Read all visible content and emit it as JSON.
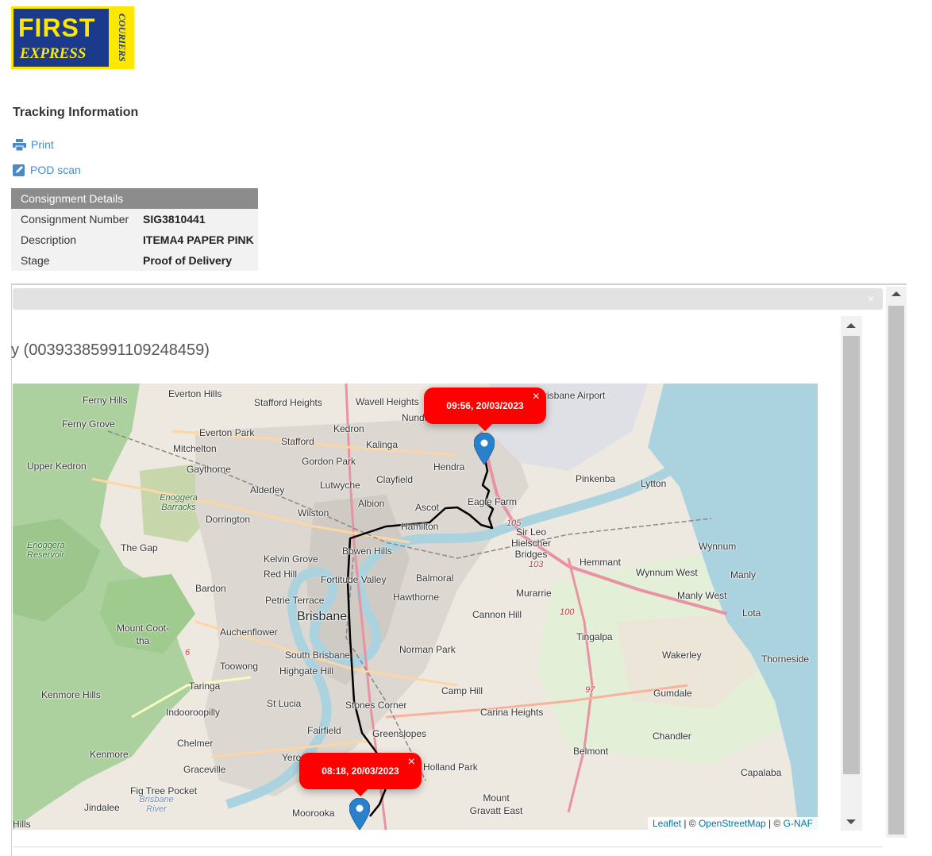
{
  "logo": {
    "first": "FIRST",
    "express": "EXPRESS",
    "couriers": "COURIERS"
  },
  "page": {
    "title": "Tracking Information"
  },
  "actions": {
    "print": "Print",
    "pod_scan": "POD scan"
  },
  "consignment": {
    "header": "Consignment Details",
    "rows": [
      {
        "label": "Consignment Number",
        "value": "SIG3810441"
      },
      {
        "label": "Description",
        "value": "ITEMA4 PAPER PINK"
      },
      {
        "label": "Stage",
        "value": "Proof of Delivery"
      }
    ]
  },
  "modal": {
    "close": "×",
    "tracking_heading": "y (00393385991109248459)"
  },
  "map": {
    "popups": [
      {
        "time": "09:56, 20/03/2023",
        "close": "×"
      },
      {
        "time": "08:18, 20/03/2023",
        "close": "×"
      }
    ],
    "attribution": {
      "leaflet": "Leaflet",
      "sep1": " | © ",
      "osm": "OpenStreetMap",
      "sep2": " | © ",
      "gnaf": "G-NAF"
    },
    "places": [
      "Ferny Hills",
      "Everton Hills",
      "Stafford Heights",
      "Wavell Heights",
      "Nundah",
      "Ferny Grove",
      "Everton Park",
      "Kedron",
      "Stafford",
      "Kalinga",
      "Mitchelton",
      "Gordon Park",
      "Hendra",
      "Upper Kedron",
      "Gaythorne",
      "Lutwyche",
      "Clayfield",
      "Pinkenba",
      "Lytton",
      "Alderley",
      "Albion",
      "Eagle Farm",
      "Ascot",
      "Enoggera Barracks",
      "Dorrington",
      "Wilston",
      "Hamilton",
      "Sir Leo Hielscher Bridges",
      "Enoggera Reservoir",
      "The Gap",
      "Bowen Hills",
      "Wynnum",
      "Kelvin Grove",
      "Hemmant",
      "Red Hill",
      "Fortitude Valley",
      "Balmoral",
      "Wynnum West",
      "Manly",
      "Bardon",
      "Petrie Terrace",
      "Hawthorne",
      "Murarrie",
      "Manly West",
      "Brisbane",
      "Cannon Hill",
      "Lota",
      "Mount Coot-tha",
      "Auchenflower",
      "Tingalpa",
      "Norman Park",
      "South Brisbane",
      "Toowong",
      "Wakerley",
      "Thorneside",
      "Highgate Hill",
      "Taringa",
      "Camp Hill",
      "Gumdale",
      "Kenmore Hills",
      "St Lucia",
      "Stones Corner",
      "Indooroopilly",
      "Carina Heights",
      "Fairfield",
      "Greenslopes",
      "Chandler",
      "Chelmer",
      "Belmont",
      "Kenmore",
      "Graceville",
      "Holland Park",
      "Capalaba",
      "Yeronga",
      "Fig Tree Pocket",
      "Brisbane River",
      "Mount Gravatt East",
      "Jindalee",
      "Moorooka",
      "Hills",
      "Brisbane Airport",
      "105",
      "103",
      "100",
      "97",
      "6"
    ]
  },
  "colors": {
    "accent_link": "#4a8ac9",
    "popup": "#ff0000",
    "marker": "#2a81cb",
    "header_grey": "#8c8c8c"
  }
}
